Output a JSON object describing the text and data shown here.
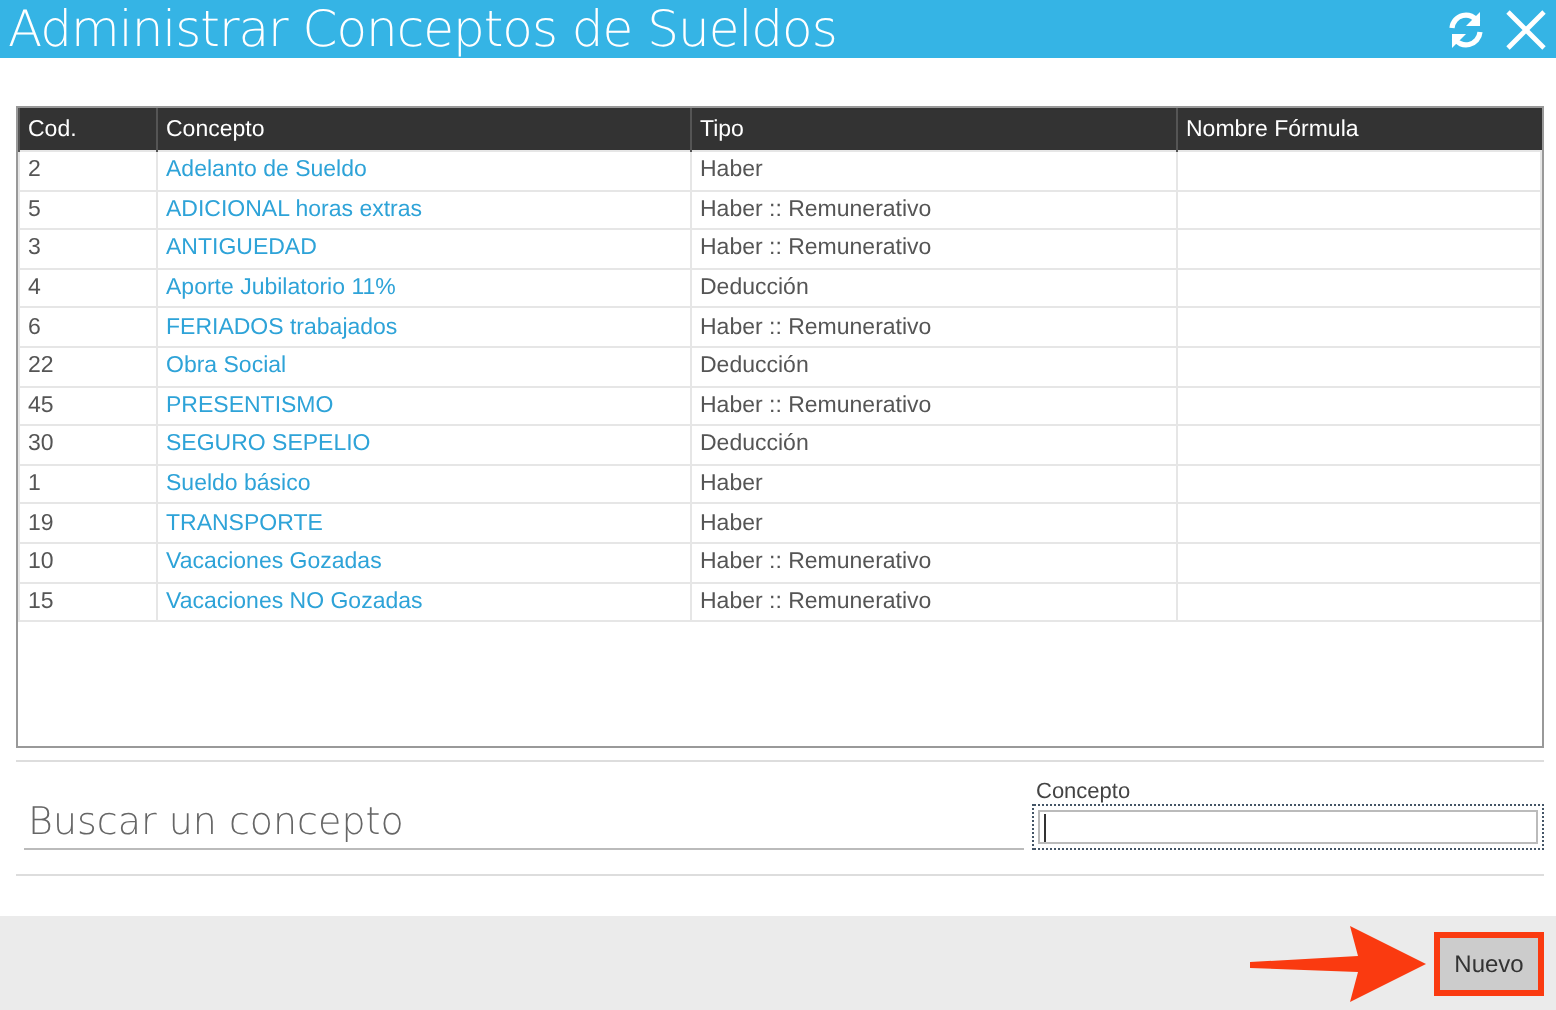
{
  "window": {
    "title": "Administrar Conceptos de Sueldos"
  },
  "table": {
    "columns": [
      "Cod.",
      "Concepto",
      "Tipo",
      "Nombre Fórmula"
    ],
    "rows": [
      {
        "cod": "2",
        "concepto": "Adelanto de Sueldo",
        "tipo": "Haber"
      },
      {
        "cod": "5",
        "concepto": "ADICIONAL horas extras",
        "tipo": "Haber :: Remunerativo"
      },
      {
        "cod": "3",
        "concepto": "ANTIGUEDAD",
        "tipo": "Haber :: Remunerativo"
      },
      {
        "cod": "4",
        "concepto": "Aporte Jubilatorio 11%",
        "tipo": "Deducción"
      },
      {
        "cod": "6",
        "concepto": "FERIADOS trabajados",
        "tipo": "Haber :: Remunerativo"
      },
      {
        "cod": "22",
        "concepto": "Obra Social",
        "tipo": "Deducción"
      },
      {
        "cod": "45",
        "concepto": "PRESENTISMO",
        "tipo": "Haber :: Remunerativo"
      },
      {
        "cod": "30",
        "concepto": "SEGURO SEPELIO",
        "tipo": "Deducción"
      },
      {
        "cod": "1",
        "concepto": "Sueldo básico",
        "tipo": "Haber"
      },
      {
        "cod": "19",
        "concepto": "TRANSPORTE",
        "tipo": "Haber"
      },
      {
        "cod": "10",
        "concepto": "Vacaciones Gozadas",
        "tipo": "Haber :: Remunerativo"
      },
      {
        "cod": "15",
        "concepto": "Vacaciones NO Gozadas",
        "tipo": "Haber :: Remunerativo"
      }
    ]
  },
  "search": {
    "placeholder": "Buscar un concepto"
  },
  "concepto_field": {
    "label": "Concepto"
  },
  "buttons": [
    "Nuevo"
  ]
}
